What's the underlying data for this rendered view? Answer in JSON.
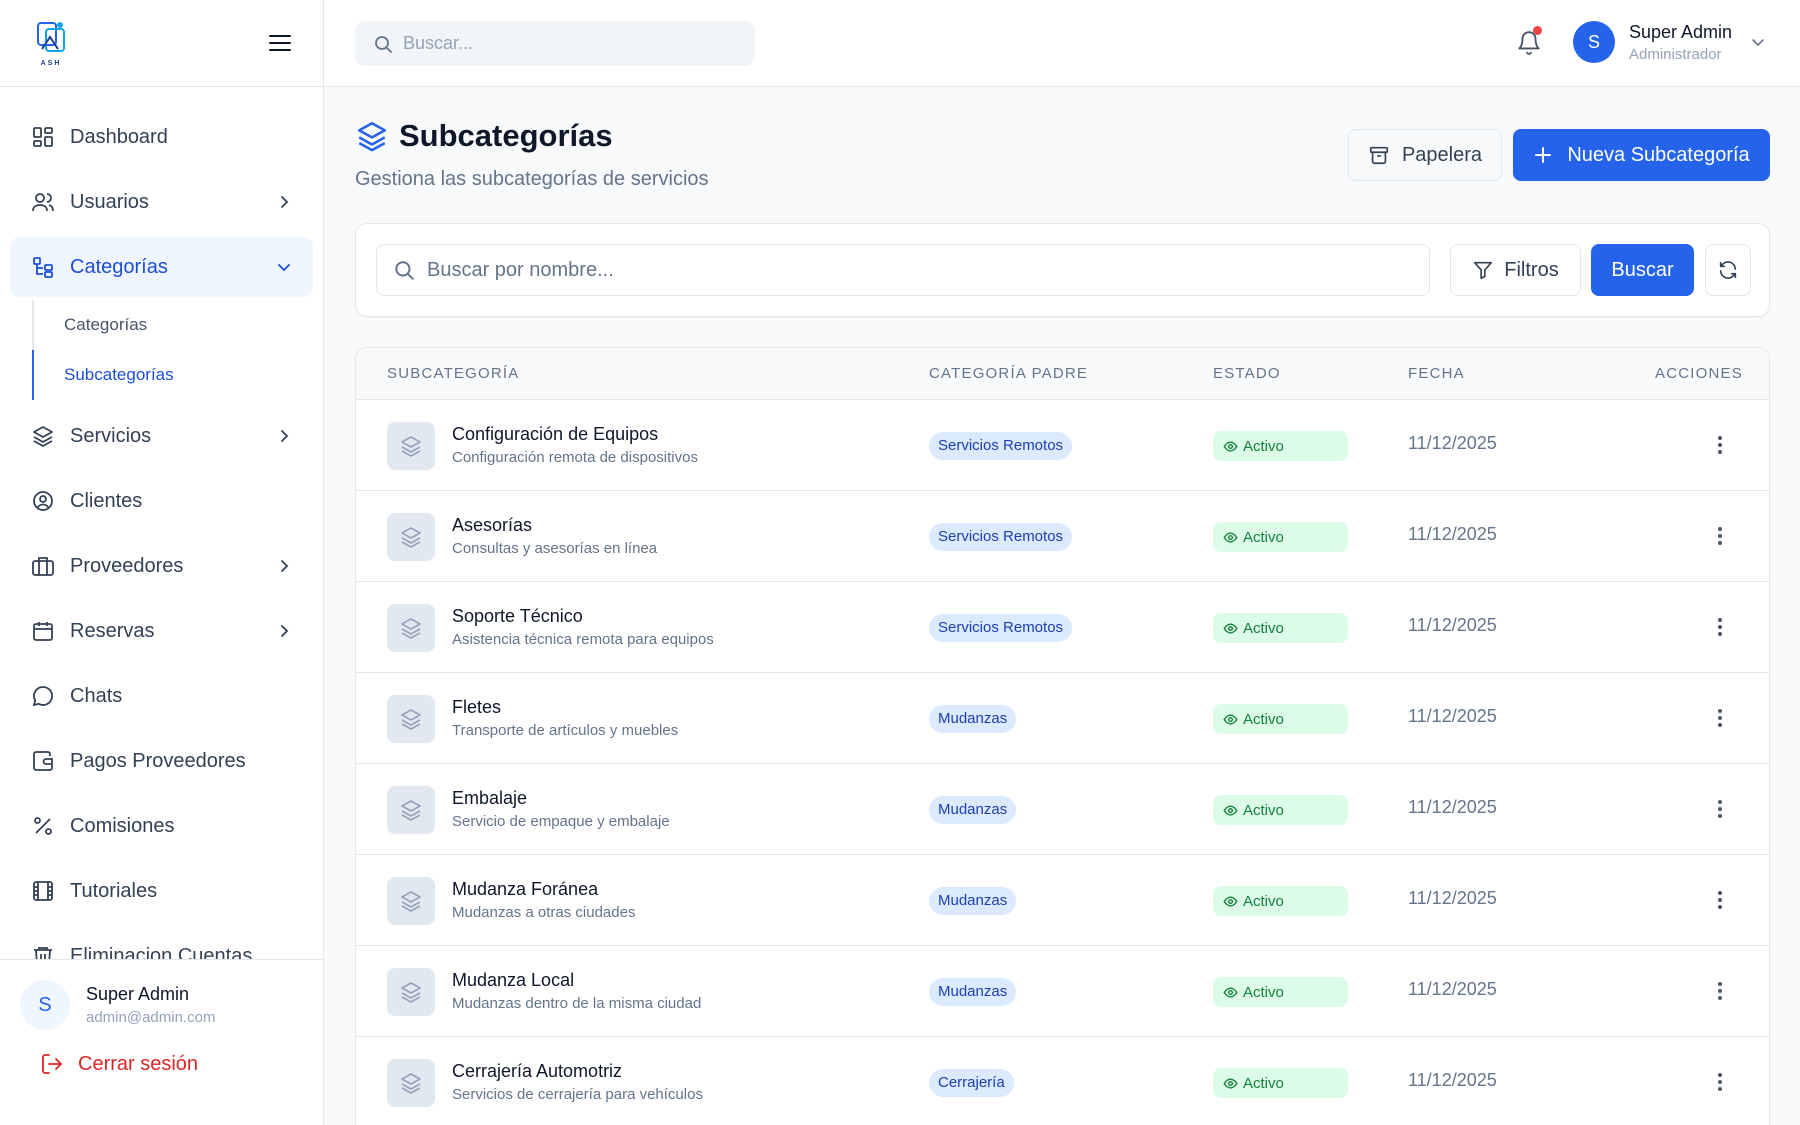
{
  "app": {
    "logo_text": "ASH"
  },
  "sidebar": {
    "items": [
      {
        "label": "Dashboard",
        "icon": "dashboard-icon"
      },
      {
        "label": "Usuarios",
        "icon": "users-icon"
      },
      {
        "label": "Categorías",
        "icon": "categories-icon",
        "active": true
      },
      {
        "label": "Servicios",
        "icon": "layers-icon"
      },
      {
        "label": "Clientes",
        "icon": "user-circle-icon"
      },
      {
        "label": "Proveedores",
        "icon": "briefcase-icon"
      },
      {
        "label": "Reservas",
        "icon": "calendar-icon"
      },
      {
        "label": "Chats",
        "icon": "chat-icon"
      },
      {
        "label": "Pagos Proveedores",
        "icon": "wallet-icon"
      },
      {
        "label": "Comisiones",
        "icon": "percent-icon"
      },
      {
        "label": "Tutoriales",
        "icon": "film-icon"
      },
      {
        "label": "Eliminacion Cuentas",
        "icon": "trash-icon"
      }
    ],
    "subitems": [
      {
        "label": "Categorías"
      },
      {
        "label": "Subcategorías",
        "active": true
      }
    ],
    "user": {
      "initial": "S",
      "name": "Super Admin",
      "email": "admin@admin.com"
    },
    "logout_label": "Cerrar sesión"
  },
  "topbar": {
    "search_placeholder": "Buscar...",
    "profile": {
      "initial": "S",
      "name": "Super Admin",
      "role": "Administrador"
    }
  },
  "page": {
    "title": "Subcategorías",
    "subtitle": "Gestiona las subcategorías de servicios",
    "trash_button": "Papelera",
    "new_button": "Nueva Subcategoría"
  },
  "filters": {
    "search_placeholder": "Buscar por nombre...",
    "filters_button": "Filtros",
    "search_button": "Buscar"
  },
  "table": {
    "headers": [
      "SUBCATEGORÍA",
      "CATEGORÍA PADRE",
      "ESTADO",
      "FECHA",
      "ACCIONES"
    ],
    "rows": [
      {
        "name": "Configuración de Equipos",
        "desc": "Configuración remota de dispositivos",
        "parent": "Servicios Remotos",
        "status": "Activo",
        "date": "11/12/2025"
      },
      {
        "name": "Asesorías",
        "desc": "Consultas y asesorías en línea",
        "parent": "Servicios Remotos",
        "status": "Activo",
        "date": "11/12/2025"
      },
      {
        "name": "Soporte Técnico",
        "desc": "Asistencia técnica remota para equipos",
        "parent": "Servicios Remotos",
        "status": "Activo",
        "date": "11/12/2025"
      },
      {
        "name": "Fletes",
        "desc": "Transporte de artículos y muebles",
        "parent": "Mudanzas",
        "status": "Activo",
        "date": "11/12/2025"
      },
      {
        "name": "Embalaje",
        "desc": "Servicio de empaque y embalaje",
        "parent": "Mudanzas",
        "status": "Activo",
        "date": "11/12/2025"
      },
      {
        "name": "Mudanza Foránea",
        "desc": "Mudanzas a otras ciudades",
        "parent": "Mudanzas",
        "status": "Activo",
        "date": "11/12/2025"
      },
      {
        "name": "Mudanza Local",
        "desc": "Mudanzas dentro de la misma ciudad",
        "parent": "Mudanzas",
        "status": "Activo",
        "date": "11/12/2025"
      },
      {
        "name": "Cerrajería Automotriz",
        "desc": "Servicios de cerrajería para vehículos",
        "parent": "Cerrajería",
        "status": "Activo",
        "date": "11/12/2025"
      }
    ]
  },
  "colors": {
    "primary": "#2563eb",
    "danger": "#dc2626",
    "success_bg": "#dcfce7",
    "success_text": "#15803d",
    "pill_bg": "#dbeafe"
  }
}
